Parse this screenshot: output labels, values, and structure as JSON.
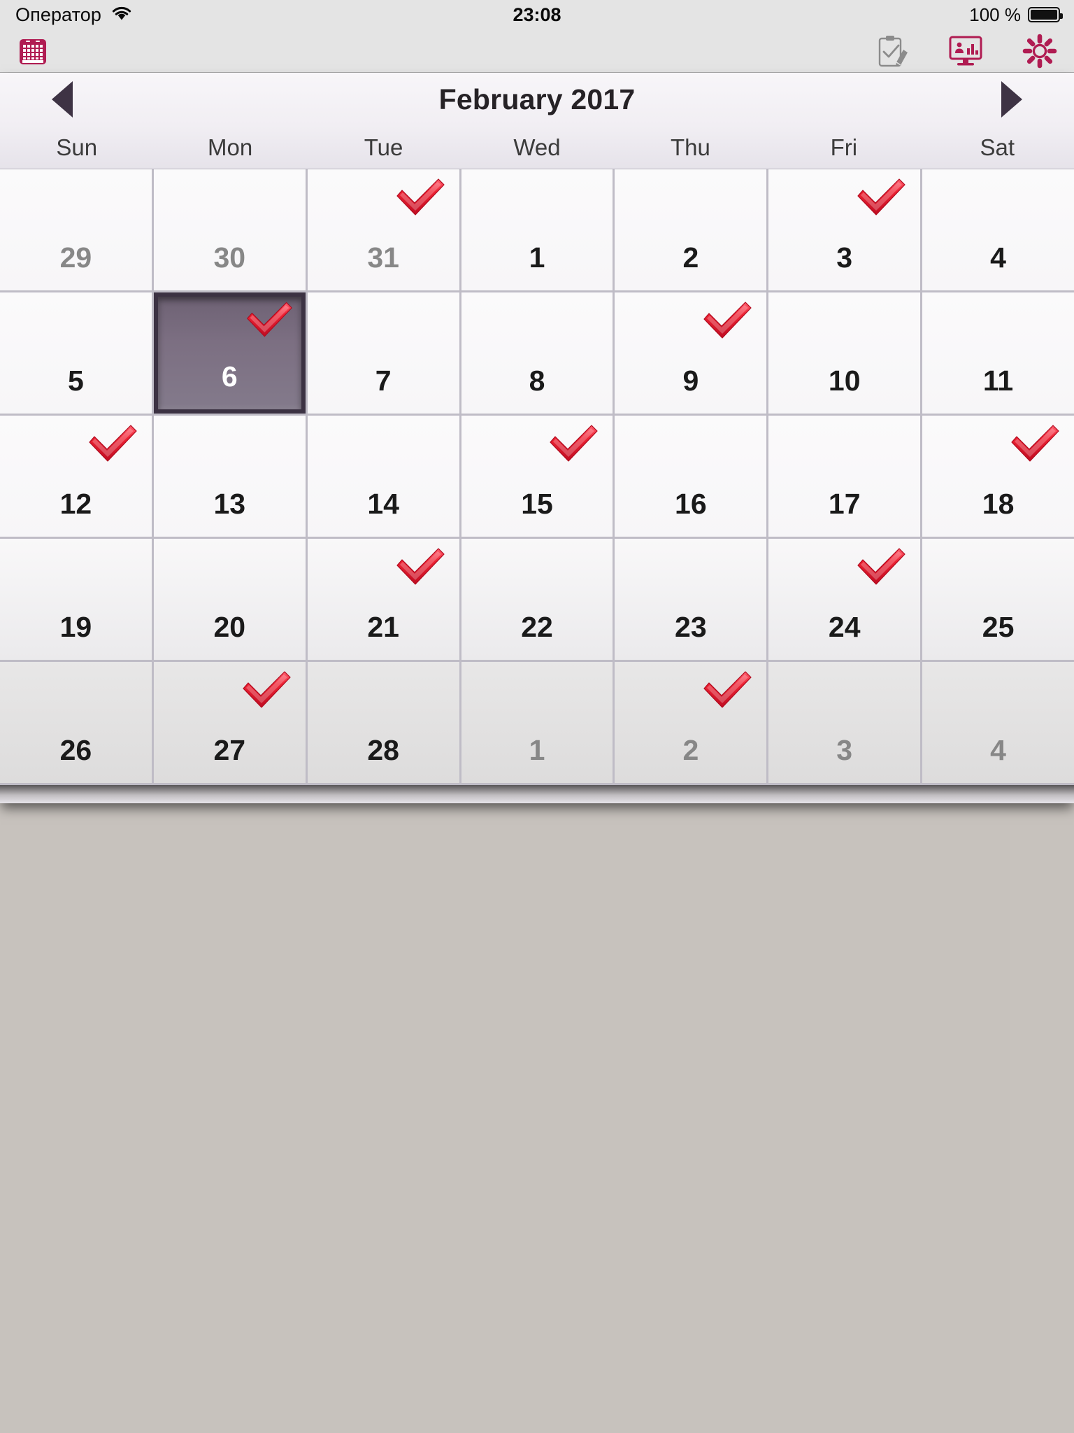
{
  "status_bar": {
    "carrier": "Оператор",
    "wifi_icon": "wifi-icon",
    "time": "23:08",
    "battery_label": "100 %",
    "battery_icon": "battery-full-icon"
  },
  "toolbar": {
    "app_icon": "calendar-icon",
    "buttons": [
      {
        "name": "notes-button",
        "icon": "clipboard-pencil-icon",
        "color": "#8b8b8b"
      },
      {
        "name": "reports-button",
        "icon": "monitor-chart-icon",
        "color": "#b01c52"
      },
      {
        "name": "settings-button",
        "icon": "gear-icon",
        "color": "#b01c52"
      }
    ]
  },
  "calendar": {
    "title": "February 2017",
    "prev_label": "◀",
    "next_label": "▶",
    "prev_icon": "chevron-left-icon",
    "next_icon": "chevron-right-icon",
    "accent_color": "#b01c52",
    "selected_color": "#7c6f82",
    "check_color": "#ee2233",
    "weekdays": [
      "Sun",
      "Mon",
      "Tue",
      "Wed",
      "Thu",
      "Fri",
      "Sat"
    ],
    "days": [
      {
        "n": "29",
        "muted": true,
        "check": false,
        "selected": false
      },
      {
        "n": "30",
        "muted": true,
        "check": false,
        "selected": false
      },
      {
        "n": "31",
        "muted": true,
        "check": true,
        "selected": false
      },
      {
        "n": "1",
        "muted": false,
        "check": false,
        "selected": false
      },
      {
        "n": "2",
        "muted": false,
        "check": false,
        "selected": false
      },
      {
        "n": "3",
        "muted": false,
        "check": true,
        "selected": false
      },
      {
        "n": "4",
        "muted": false,
        "check": false,
        "selected": false
      },
      {
        "n": "5",
        "muted": false,
        "check": false,
        "selected": false
      },
      {
        "n": "6",
        "muted": false,
        "check": true,
        "selected": true
      },
      {
        "n": "7",
        "muted": false,
        "check": false,
        "selected": false
      },
      {
        "n": "8",
        "muted": false,
        "check": false,
        "selected": false
      },
      {
        "n": "9",
        "muted": false,
        "check": true,
        "selected": false
      },
      {
        "n": "10",
        "muted": false,
        "check": false,
        "selected": false
      },
      {
        "n": "11",
        "muted": false,
        "check": false,
        "selected": false
      },
      {
        "n": "12",
        "muted": false,
        "check": true,
        "selected": false
      },
      {
        "n": "13",
        "muted": false,
        "check": false,
        "selected": false
      },
      {
        "n": "14",
        "muted": false,
        "check": false,
        "selected": false
      },
      {
        "n": "15",
        "muted": false,
        "check": true,
        "selected": false
      },
      {
        "n": "16",
        "muted": false,
        "check": false,
        "selected": false
      },
      {
        "n": "17",
        "muted": false,
        "check": false,
        "selected": false
      },
      {
        "n": "18",
        "muted": false,
        "check": true,
        "selected": false
      },
      {
        "n": "19",
        "muted": false,
        "check": false,
        "selected": false
      },
      {
        "n": "20",
        "muted": false,
        "check": false,
        "selected": false
      },
      {
        "n": "21",
        "muted": false,
        "check": true,
        "selected": false
      },
      {
        "n": "22",
        "muted": false,
        "check": false,
        "selected": false
      },
      {
        "n": "23",
        "muted": false,
        "check": false,
        "selected": false
      },
      {
        "n": "24",
        "muted": false,
        "check": true,
        "selected": false
      },
      {
        "n": "25",
        "muted": false,
        "check": false,
        "selected": false
      },
      {
        "n": "26",
        "muted": false,
        "check": false,
        "selected": false
      },
      {
        "n": "27",
        "muted": false,
        "check": true,
        "selected": false
      },
      {
        "n": "28",
        "muted": false,
        "check": false,
        "selected": false
      },
      {
        "n": "1",
        "muted": true,
        "check": false,
        "selected": false
      },
      {
        "n": "2",
        "muted": true,
        "check": true,
        "selected": false
      },
      {
        "n": "3",
        "muted": true,
        "check": false,
        "selected": false
      },
      {
        "n": "4",
        "muted": true,
        "check": false,
        "selected": false
      }
    ]
  }
}
